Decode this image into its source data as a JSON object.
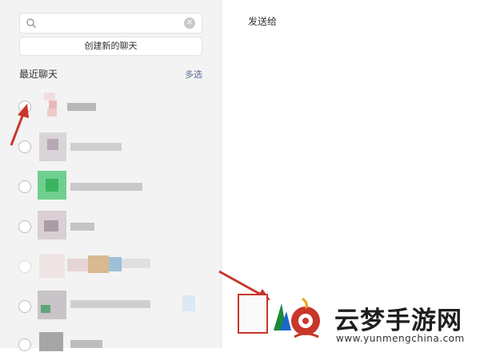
{
  "search": {
    "value": "",
    "placeholder": ""
  },
  "new_chat_label": "创建新的聊天",
  "recent": {
    "title": "最近聊天",
    "multi_select": "多选"
  },
  "send_to_label": "发送给",
  "colors": {
    "accent_link": "#576b95",
    "annotation_red": "#c9362a",
    "panel_bg": "#f3f3f3"
  },
  "watermark": {
    "text": "云梦手游网",
    "url": "www.yunmengchina.com"
  }
}
